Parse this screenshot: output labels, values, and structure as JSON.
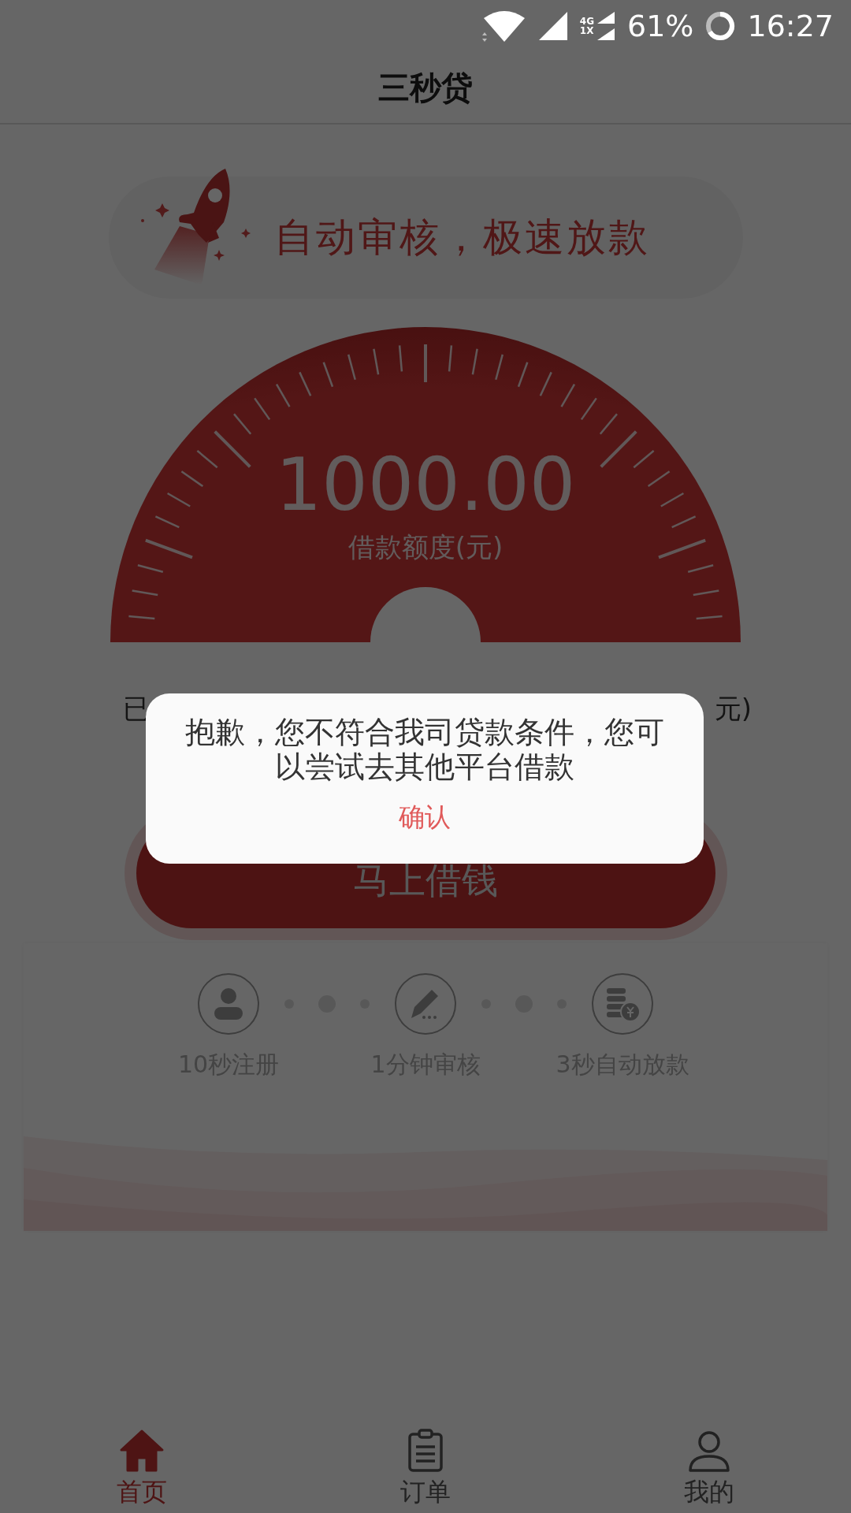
{
  "status_bar": {
    "network_top": "4G",
    "network_bottom": "1X",
    "battery": "61%",
    "time": "16:27"
  },
  "header": {
    "title": "三秒贷"
  },
  "banner": {
    "text": "自动审核，极速放款"
  },
  "gauge": {
    "amount": "1000.00",
    "label": "借款额度(元)"
  },
  "limit_line": {
    "left": "已",
    "right": "元)"
  },
  "borrow_button": {
    "label": "马上借钱"
  },
  "steps": [
    {
      "kind": "user",
      "label": "10秒注册"
    },
    {
      "kind": "pen",
      "label": "1分钟审核"
    },
    {
      "kind": "coins",
      "label": "3秒自动放款"
    }
  ],
  "bottom_nav": [
    {
      "kind": "home",
      "label": "首页",
      "selected": true
    },
    {
      "kind": "orders",
      "label": "订单",
      "selected": false
    },
    {
      "kind": "profile",
      "label": "我的",
      "selected": false
    }
  ],
  "dialog": {
    "message": "抱歉，您不符合我司贷款条件，您可以尝试去其他平台借款",
    "confirm": "确认"
  }
}
